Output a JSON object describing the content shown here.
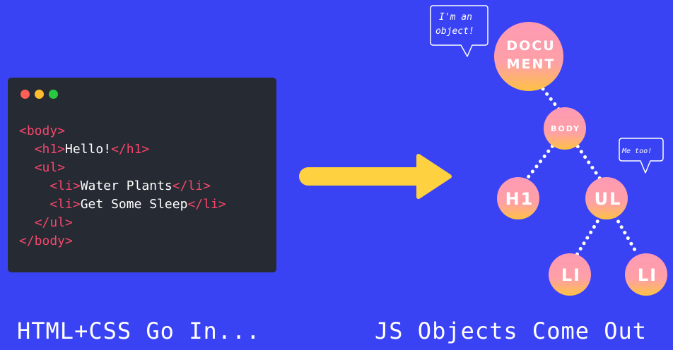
{
  "code_window": {
    "dots": [
      "red",
      "yellow",
      "green"
    ],
    "lines": [
      {
        "indent": "",
        "open": "<body>",
        "text": "",
        "close": ""
      },
      {
        "indent": "  ",
        "open": "<h1>",
        "text": "Hello!",
        "close": "</h1>"
      },
      {
        "indent": "  ",
        "open": "<ul>",
        "text": "",
        "close": ""
      },
      {
        "indent": "    ",
        "open": "<li>",
        "text": "Water Plants",
        "close": "</li>"
      },
      {
        "indent": "    ",
        "open": "<li>",
        "text": "Get Some Sleep",
        "close": "</li>"
      },
      {
        "indent": "  ",
        "open": "</ul>",
        "text": "",
        "close": ""
      },
      {
        "indent": "",
        "open": "</body>",
        "text": "",
        "close": ""
      }
    ]
  },
  "arrow": {
    "color": "#fdd13f"
  },
  "tree": {
    "nodes": {
      "document": {
        "label_line1": "DOCU",
        "label_line2": "MENT"
      },
      "body": {
        "label": "BODY"
      },
      "h1": {
        "label": "H1"
      },
      "ul": {
        "label": "UL"
      },
      "li_left": {
        "label": "LI"
      },
      "li_right": {
        "label": "LI"
      }
    },
    "bubbles": {
      "document": {
        "line1": "I'm an",
        "line2": "object!"
      },
      "ul": {
        "text": "Me too!"
      }
    },
    "colors": {
      "node_top": "#fe9ab4",
      "node_bottom": "#fec144",
      "edge": "#ffffff"
    }
  },
  "captions": {
    "left": "HTML+CSS Go In...",
    "right": "JS Objects Come Out"
  },
  "colors": {
    "background": "#3a43f4",
    "code_bg": "#262a33",
    "tag": "#f4476b"
  }
}
